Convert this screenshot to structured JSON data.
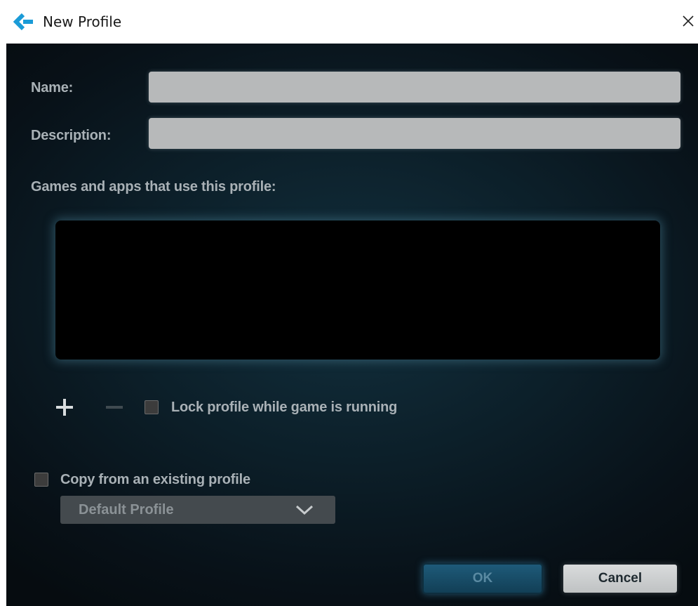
{
  "window": {
    "title": "New Profile",
    "app_icon": "logitech-g-icon",
    "close_icon": "close-icon"
  },
  "form": {
    "name_label": "Name:",
    "name_value": "",
    "description_label": "Description:",
    "description_value": "",
    "apps_label": "Games and apps that use this profile:",
    "apps_list_items": [],
    "add_icon": "plus-icon",
    "remove_icon": "minus-icon",
    "lock_checkbox_checked": false,
    "lock_label": "Lock profile while game is running",
    "copy_checkbox_checked": false,
    "copy_label": "Copy from an existing profile",
    "copy_dropdown_value": "Default Profile",
    "dropdown_icon": "chevron-down-icon"
  },
  "buttons": {
    "ok_label": "OK",
    "cancel_label": "Cancel"
  },
  "colors": {
    "accent": "#1a9bd7",
    "background": "#0c1f29",
    "ok_button": "#1e5a79",
    "cancel_button": "#cfd1d2"
  }
}
